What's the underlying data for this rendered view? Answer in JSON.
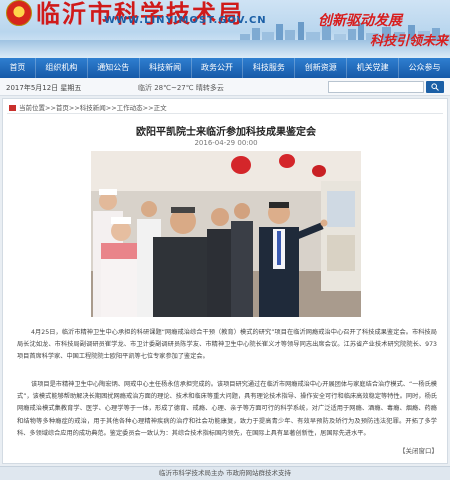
{
  "header": {
    "site_title": "临沂市科学技术局",
    "site_url": "WWW.LINYIMOST.GOV.CN",
    "slogan_line1": "创新驱动发展",
    "slogan_line2": "科技引领未来"
  },
  "nav": {
    "items": [
      "首页",
      "组织机构",
      "通知公告",
      "科技新闻",
      "政务公开",
      "科技服务",
      "创新资源",
      "机关党建",
      "公众参与"
    ]
  },
  "infobar": {
    "date": "2017年5月12日   星期五",
    "weather": "临沂 28℃~27℃ 晴转多云",
    "search_placeholder": ""
  },
  "breadcrumb": {
    "text": "当前位置>>首页>>科技新闻>>工作动态>>正文"
  },
  "article": {
    "title": "欧阳平凯院士来临沂参加科技成果鉴定会",
    "date": "2016-04-29 00:00",
    "paragraph1": "4月25日，临沂市精神卫生中心承担的科研课题“网瘾戒治综合干预（教育）模式的研究”项目在临沂网瘾戒治中心召开了科技成果鉴定会。市科技局局长沈如龙、市科技局副调研员崔学龙、市卫计委副调研员陈学友、市精神卫生中心院长崔义才等领导同志出席会议。江苏省产业技术研究院院长、973项目首席科学家、中国工程院院士欧阳平凯等七位专家参加了鉴定会。",
    "paragraph2": "该项目是市精神卫生中心陶宏炳、网戒中心主任杨永信承担完成的。该项目研究通过在临沂市网瘾戒治中心开展团体与家庭结合治疗模式、“一杨氏模式”，该模式能够帮助解决长期困扰网瘾戒治方面的理论、技术和临床等重大问题，具有理论技术指导、操作安全可行和临床高效稳定等特性。同时，杨氏网瘾戒治模式集教育学、医学、心理学等于一体，形成了德育、戒瘾、心理、亲子等方面可行的科学系统，对广泛适用于网瘾、酒瘾、毒瘾、烟瘾、药瘾和结物等多种瘾症的戒治，用于其他各种心理精神疾病的治疗和社会功能康复，致力于提高青少年、有效早预防及矫行为及预防违法犯罪。开拓了多学科、多领域综合应用的成功典范。鉴定委员会一致认为：其综合技术指标国内领先，在国际上具有显著创新性，居国际先进水平。",
    "close_label": "【关闭窗口】"
  },
  "footer": {
    "text": "临沂市科学技术局主办  市政府网站群技术支持"
  },
  "colors": {
    "brand_red": "#d01a1a",
    "nav_blue": "#1b5fa6"
  }
}
